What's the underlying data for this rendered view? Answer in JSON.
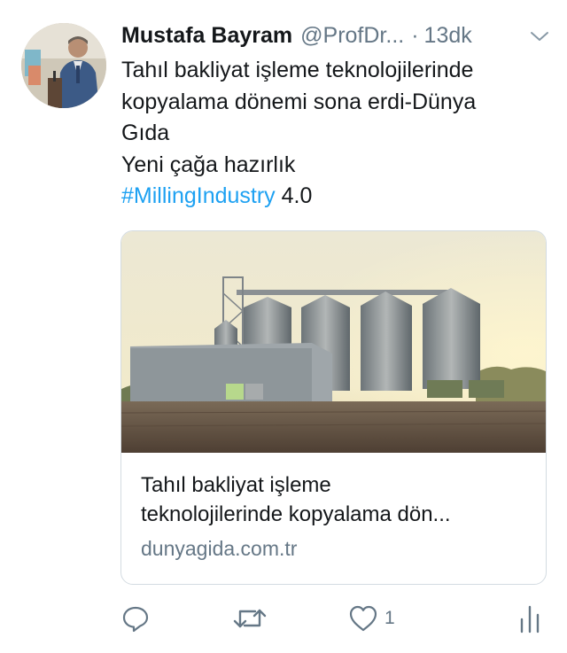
{
  "tweet": {
    "author_name": "Mustafa Bayram",
    "handle": "@ProfDr...",
    "separator": "·",
    "time": "13dk",
    "text_lines": [
      "Tahıl bakliyat işleme teknolojilerinde",
      "kopyalama dönemi sona erdi-Dünya",
      "Gıda",
      "Yeni çağa hazırlık"
    ],
    "hashtag": "#MillingIndustry",
    "hashtag_suffix": " 4.0"
  },
  "card": {
    "title_lines": [
      "Tahıl bakliyat işleme",
      "teknolojilerinde kopyalama dön..."
    ],
    "domain": "dunyagida.com.tr"
  },
  "actions": {
    "reply_icon": "reply-icon",
    "retweet_icon": "retweet-icon",
    "like_icon": "heart-icon",
    "like_count": "1",
    "analytics_icon": "analytics-icon"
  },
  "colors": {
    "link": "#1da1f2",
    "secondary": "#657786",
    "primary_text": "#14171a"
  }
}
